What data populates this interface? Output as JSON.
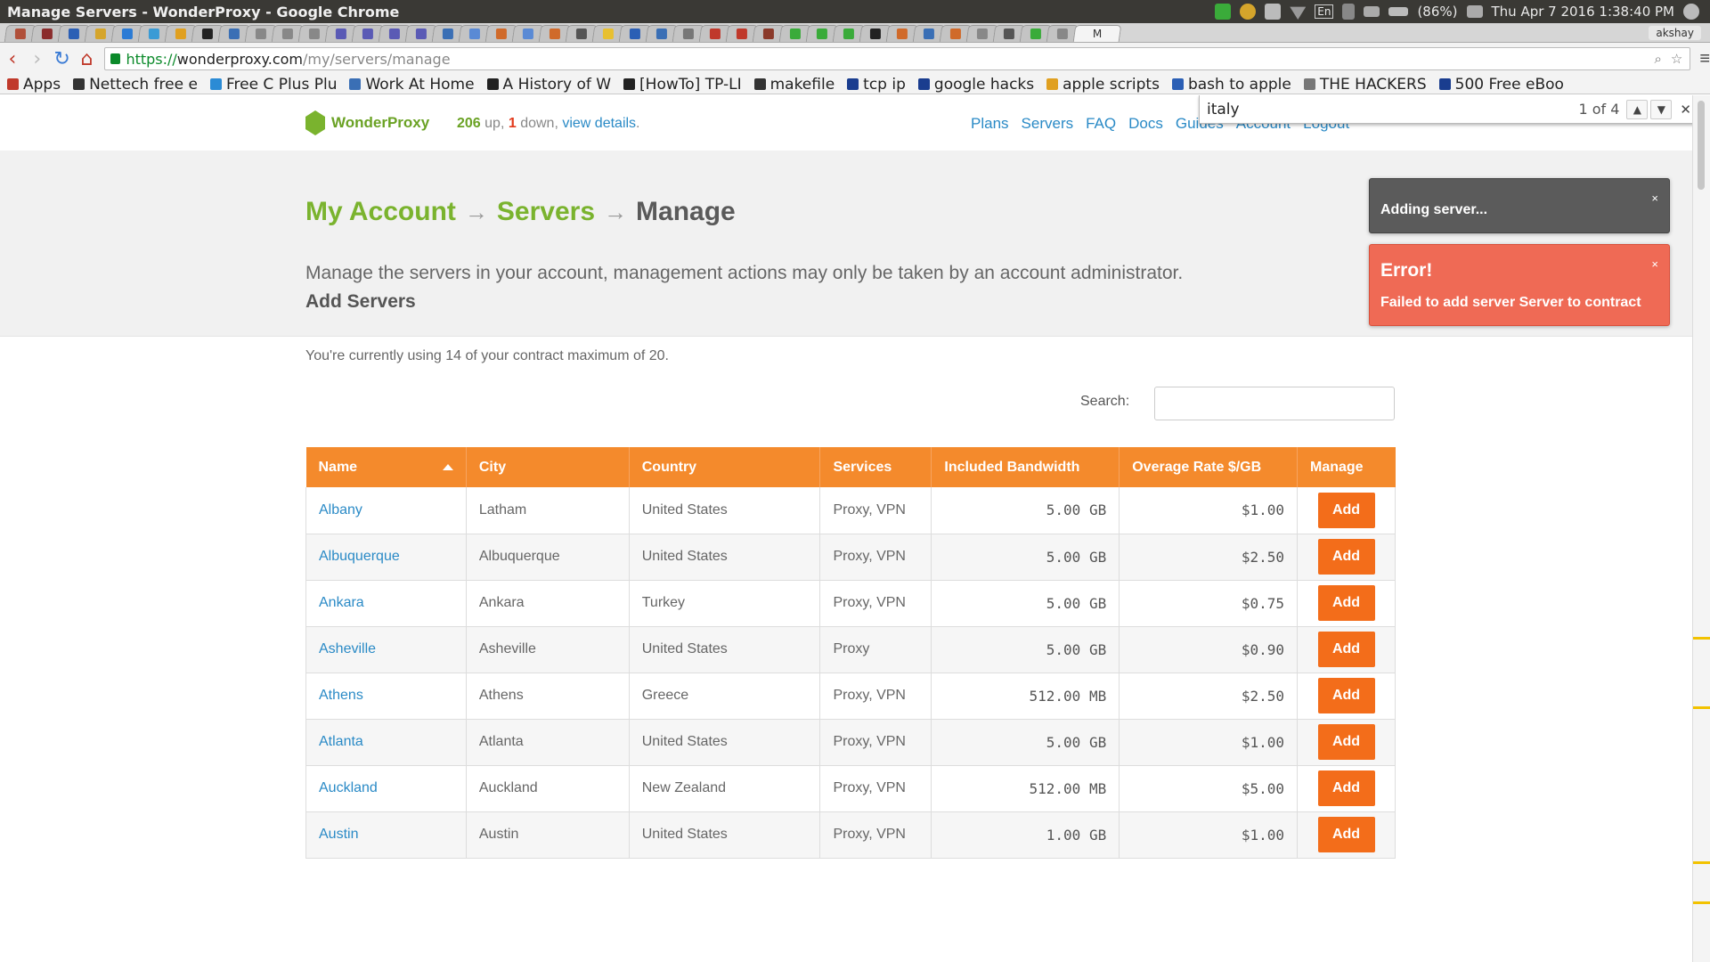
{
  "window": {
    "title": "Manage Servers - WonderProxy - Google Chrome",
    "battery": "(86%)",
    "clock": "Thu Apr  7 2016  1:38:40 PM",
    "keyboard": "En",
    "user": "akshay"
  },
  "tabs": {
    "colors": [
      "#b0503a",
      "#8b2c2c",
      "#2b5fb5",
      "#d5a52b",
      "#2b7bd5",
      "#3a9bd5",
      "#e0a020",
      "#222",
      "#3a6fb5",
      "#888",
      "#888",
      "#888",
      "#5a5ab5",
      "#5a5ab5",
      "#5a5ab5",
      "#5a5ab5",
      "#3a6fb5",
      "#5a8ad5",
      "#d06a2a",
      "#5a8ad5",
      "#d06a2a",
      "#555",
      "#e8c030",
      "#2b5fb5",
      "#3a6fb5",
      "#777",
      "#c0392b",
      "#c0392b",
      "#8b3a2a",
      "#3aab3a",
      "#3aab3a",
      "#3aab3a",
      "#222",
      "#d06a2a",
      "#3a6fb5",
      "#d06a2a",
      "#888",
      "#555",
      "#3aab3a",
      "#888"
    ],
    "active_label": "M"
  },
  "omnibox": {
    "scheme": "https://",
    "host": "wonderproxy.com",
    "path": "/my/servers/manage"
  },
  "bookmarks": [
    {
      "label": "Apps",
      "color": "#c0392b"
    },
    {
      "label": "Nettech free e",
      "color": "#333"
    },
    {
      "label": "Free C Plus Plu",
      "color": "#2b8bd5"
    },
    {
      "label": "Work At Home",
      "color": "#3a6fb5"
    },
    {
      "label": "A History of W",
      "color": "#222"
    },
    {
      "label": "[HowTo] TP-LI",
      "color": "#222"
    },
    {
      "label": "makefile",
      "color": "#333"
    },
    {
      "label": "tcp ip",
      "color": "#1a3d8f"
    },
    {
      "label": "google hacks",
      "color": "#1a3d8f"
    },
    {
      "label": "apple scripts",
      "color": "#e0a020"
    },
    {
      "label": "bash to apple",
      "color": "#2b5fb5"
    },
    {
      "label": "THE HACKERS",
      "color": "#777"
    },
    {
      "label": "500 Free eBoo",
      "color": "#1a3d8f"
    }
  ],
  "find": {
    "query": "italy",
    "count": "1 of 4"
  },
  "site": {
    "logo_text": "WonderProxy",
    "status_up": "206",
    "status_up_text": " up, ",
    "status_down": "1",
    "status_down_text": " down, ",
    "status_link": "view details",
    "status_period": ".",
    "nav": [
      "Plans",
      "Servers",
      "FAQ",
      "Docs",
      "Guides",
      "Account",
      "Logout"
    ]
  },
  "hero": {
    "crumb_account": "My Account",
    "crumb_servers": "Servers",
    "crumb_current": "Manage",
    "arrow": "→",
    "description": "Manage the servers in your account, management actions may only be taken by an account administrator."
  },
  "toasts": {
    "adding": "Adding server...",
    "error_title": "Error!",
    "error_message": "Failed to add server Server to contract",
    "close": "×"
  },
  "section": {
    "title": "Add Servers",
    "usage": "You're currently using 14 of your contract maximum of 20.",
    "search_label": "Search:"
  },
  "table": {
    "columns": [
      "Name",
      "City",
      "Country",
      "Services",
      "Included Bandwidth",
      "Overage Rate $/GB",
      "Manage"
    ],
    "action_label": "Add",
    "rows": [
      {
        "name": "Albany",
        "city": "Latham",
        "country": "United States",
        "services": "Proxy, VPN",
        "bandwidth": "5.00 GB",
        "rate": "$1.00"
      },
      {
        "name": "Albuquerque",
        "city": "Albuquerque",
        "country": "United States",
        "services": "Proxy, VPN",
        "bandwidth": "5.00 GB",
        "rate": "$2.50"
      },
      {
        "name": "Ankara",
        "city": "Ankara",
        "country": "Turkey",
        "services": "Proxy, VPN",
        "bandwidth": "5.00 GB",
        "rate": "$0.75"
      },
      {
        "name": "Asheville",
        "city": "Asheville",
        "country": "United States",
        "services": "Proxy",
        "bandwidth": "5.00 GB",
        "rate": "$0.90"
      },
      {
        "name": "Athens",
        "city": "Athens",
        "country": "Greece",
        "services": "Proxy, VPN",
        "bandwidth": "512.00 MB",
        "rate": "$2.50"
      },
      {
        "name": "Atlanta",
        "city": "Atlanta",
        "country": "United States",
        "services": "Proxy, VPN",
        "bandwidth": "5.00 GB",
        "rate": "$1.00"
      },
      {
        "name": "Auckland",
        "city": "Auckland",
        "country": "New Zealand",
        "services": "Proxy, VPN",
        "bandwidth": "512.00 MB",
        "rate": "$5.00"
      },
      {
        "name": "Austin",
        "city": "Austin",
        "country": "United States",
        "services": "Proxy, VPN",
        "bandwidth": "1.00 GB",
        "rate": "$1.00"
      }
    ]
  },
  "colors": {
    "brand_green": "#7ab32e",
    "table_header": "#f48a2c",
    "add_button": "#f36d1a",
    "link_blue": "#2a8ac6",
    "error": "#ef6a55"
  }
}
